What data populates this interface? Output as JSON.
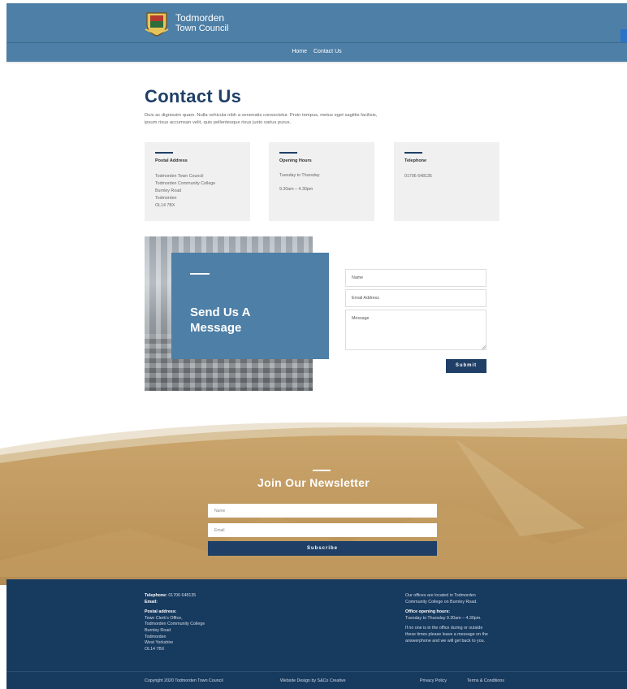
{
  "header": {
    "brand_line1": "Todmorden",
    "brand_line2": "Town Council",
    "nav": [
      "Home",
      "Contact Us"
    ]
  },
  "contact": {
    "title": "Contact Us",
    "intro": "Duis ac dignissim quam. Nulla vehicula nibh a venenatis consectetur. Proin tempus, metus eget sagittis facilisis, ipsum risus accumsan velit, quis pellentesque risus justo varius purus.",
    "cards": [
      {
        "title": "Postal Address",
        "lines": [
          "Todmorden Town Council",
          "Todmorden Community College",
          "Burnley Road",
          "Todmorden",
          "OL14 7BX"
        ]
      },
      {
        "title": "Opening Hours",
        "lines": [
          "Tuesday to Thursday",
          "",
          "9.30am – 4.30pm"
        ]
      },
      {
        "title": "Telephone",
        "lines": [
          "01706 648135"
        ]
      }
    ]
  },
  "message": {
    "title_line1": "Send Us A",
    "title_line2": "Message",
    "name_placeholder": "Name",
    "email_placeholder": "Email Address",
    "message_placeholder": "Message",
    "submit_label": "Submit"
  },
  "newsletter": {
    "title": "Join Our Newsletter",
    "name_placeholder": "Name",
    "email_placeholder": "Email",
    "subscribe_label": "Subscribe"
  },
  "footer": {
    "telephone_label": "Telephone:",
    "telephone": "01706 648135",
    "email_label": "Email:",
    "postal_label": "Postal address:",
    "postal_lines": [
      "Town Clerk's Office,",
      "Todmorden Community College",
      "Burnley Road",
      "Todmorden",
      "West Yorkshire",
      "OL14 7BX"
    ],
    "location_text": [
      "Our offices are located in Todmorden",
      "Community College on Burnley Road."
    ],
    "hours_label": "Office opening hours:",
    "hours_text": "Tuesday to Thursday 9.30am – 4.30pm.",
    "message_text": [
      "If no one is in the office during or outside",
      "these times please leave a message on the",
      "answerphone and we will get back to you."
    ],
    "copyright": "Copyright 2020 Todmorden Town Council",
    "design_credit": "Website Design by S&Co Creative",
    "privacy_link": "Privacy Policy",
    "terms_link": "Terms & Conditions"
  },
  "colors": {
    "header_blue": "#4e7fa6",
    "navy": "#1f3f66",
    "footer_navy": "#173a5f",
    "sand": "#c9a46b"
  }
}
